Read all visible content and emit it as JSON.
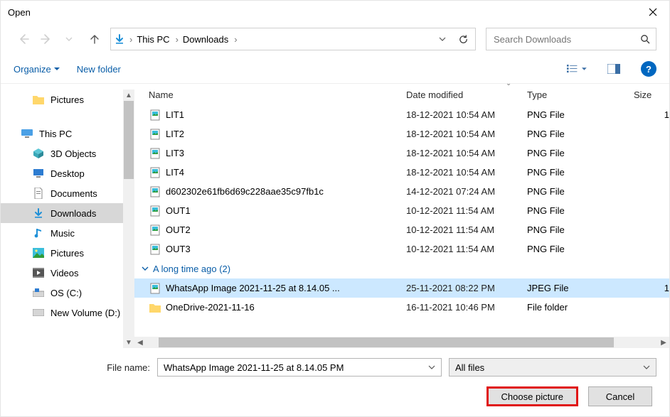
{
  "window": {
    "title": "Open"
  },
  "breadcrumbs": {
    "root": "This PC",
    "folder": "Downloads"
  },
  "search": {
    "placeholder": "Search Downloads"
  },
  "toolbar": {
    "organize": "Organize",
    "newfolder": "New folder"
  },
  "tree": {
    "pictures": "Pictures",
    "thispc": "This PC",
    "objects3d": "3D Objects",
    "desktop": "Desktop",
    "documents": "Documents",
    "downloads": "Downloads",
    "music": "Music",
    "pictures2": "Pictures",
    "videos": "Videos",
    "osc": "OS (C:)",
    "newvolume": "New Volume (D:)"
  },
  "columns": {
    "name": "Name",
    "date": "Date modified",
    "type": "Type",
    "size": "Size"
  },
  "group": {
    "label": "A long time ago (2)"
  },
  "files": [
    {
      "name": "LIT1",
      "date": "18-12-2021 10:54 AM",
      "type": "PNG File",
      "size": "1"
    },
    {
      "name": "LIT2",
      "date": "18-12-2021 10:54 AM",
      "type": "PNG File",
      "size": ""
    },
    {
      "name": "LIT3",
      "date": "18-12-2021 10:54 AM",
      "type": "PNG File",
      "size": ""
    },
    {
      "name": "LIT4",
      "date": "18-12-2021 10:54 AM",
      "type": "PNG File",
      "size": ""
    },
    {
      "name": "d602302e61fb6d69c228aae35c97fb1c",
      "date": "14-12-2021 07:24 AM",
      "type": "PNG File",
      "size": ""
    },
    {
      "name": "OUT1",
      "date": "10-12-2021 11:54 AM",
      "type": "PNG File",
      "size": ""
    },
    {
      "name": "OUT2",
      "date": "10-12-2021 11:54 AM",
      "type": "PNG File",
      "size": ""
    },
    {
      "name": "OUT3",
      "date": "10-12-2021 11:54 AM",
      "type": "PNG File",
      "size": ""
    }
  ],
  "files_old": [
    {
      "name": "WhatsApp Image 2021-11-25 at 8.14.05 ...",
      "date": "25-11-2021 08:22 PM",
      "type": "JPEG File",
      "size": "1",
      "selected": true,
      "kind": "image"
    },
    {
      "name": "OneDrive-2021-11-16",
      "date": "16-11-2021 10:46 PM",
      "type": "File folder",
      "size": "",
      "kind": "folder"
    }
  ],
  "footer": {
    "filename_label": "File name:",
    "filename_value": "WhatsApp Image 2021-11-25 at 8.14.05 PM",
    "filter": "All files",
    "open": "Choose picture",
    "cancel": "Cancel"
  }
}
